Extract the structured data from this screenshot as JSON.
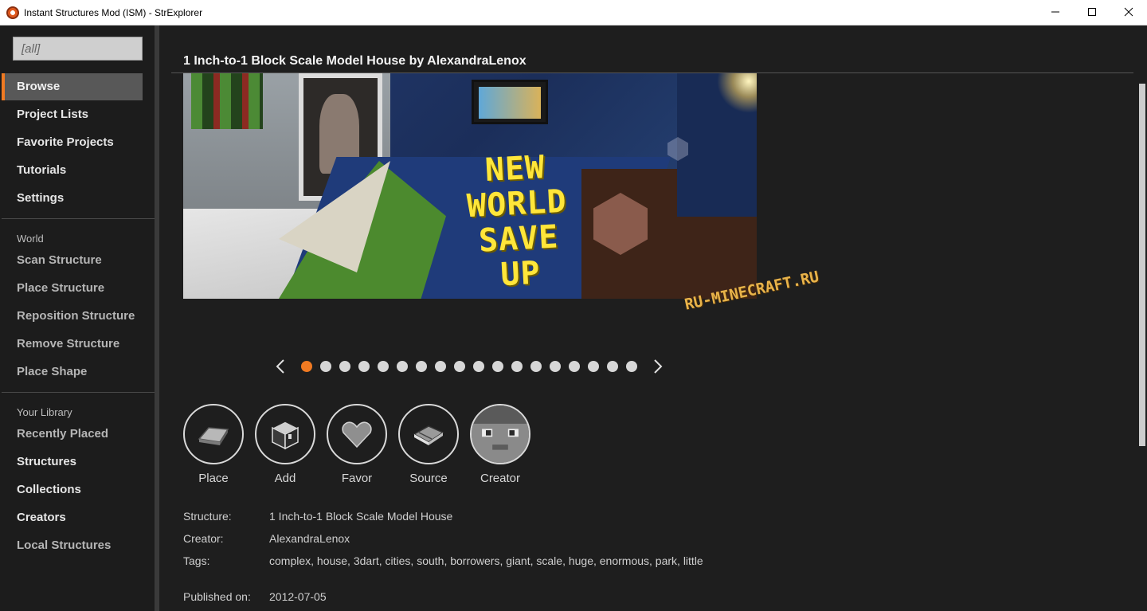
{
  "window": {
    "title": "Instant Structures Mod (ISM) - StrExplorer",
    "app_icon": "ism-logo-icon",
    "controls": [
      "minimize-icon",
      "maximize-icon",
      "close-icon"
    ]
  },
  "sidebar": {
    "search_value": "[all]",
    "nav": [
      {
        "label": "Browse",
        "active": true
      },
      {
        "label": "Project Lists"
      },
      {
        "label": "Favorite Projects"
      },
      {
        "label": "Tutorials"
      },
      {
        "label": "Settings"
      }
    ],
    "world_section": {
      "label": "World",
      "items": [
        "Scan Structure",
        "Place Structure",
        "Reposition Structure",
        "Remove Structure",
        "Place Shape"
      ]
    },
    "library_section": {
      "label": "Your Library",
      "items": [
        "Recently Placed",
        "Structures",
        "Collections",
        "Creators",
        "Local Structures"
      ]
    }
  },
  "main": {
    "title": "1 Inch-to-1 Block Scale Model House by AlexandraLenox",
    "hero": {
      "overlay_text": "NEW WORLD SAVE UP",
      "watermark": "RU-MINECRAFT.RU"
    },
    "carousel": {
      "count": 18,
      "active_index": 0,
      "prev_icon": "chevron-left-icon",
      "next_icon": "chevron-right-icon"
    },
    "actions": [
      {
        "label": "Place",
        "icon": "iron-ingot-icon"
      },
      {
        "label": "Add",
        "icon": "chest-icon"
      },
      {
        "label": "Favor",
        "icon": "heart-icon"
      },
      {
        "label": "Source",
        "icon": "book-icon"
      },
      {
        "label": "Creator",
        "icon": "creator-avatar-icon"
      }
    ],
    "details": {
      "structure_label": "Structure:",
      "structure_value": "1 Inch-to-1 Block Scale Model House",
      "creator_label": "Creator:",
      "creator_value": "AlexandraLenox",
      "tags_label": "Tags:",
      "tags_value": "complex, house, 3dart, cities, south, borrowers, giant, scale, huge, enormous, park, little",
      "published_label": "Published on:",
      "published_value": "2012-07-05"
    }
  },
  "colors": {
    "accent": "#f07a22",
    "background": "#1e1e1e",
    "sidebar": "#1c1c1c",
    "active_nav": "#585858"
  }
}
